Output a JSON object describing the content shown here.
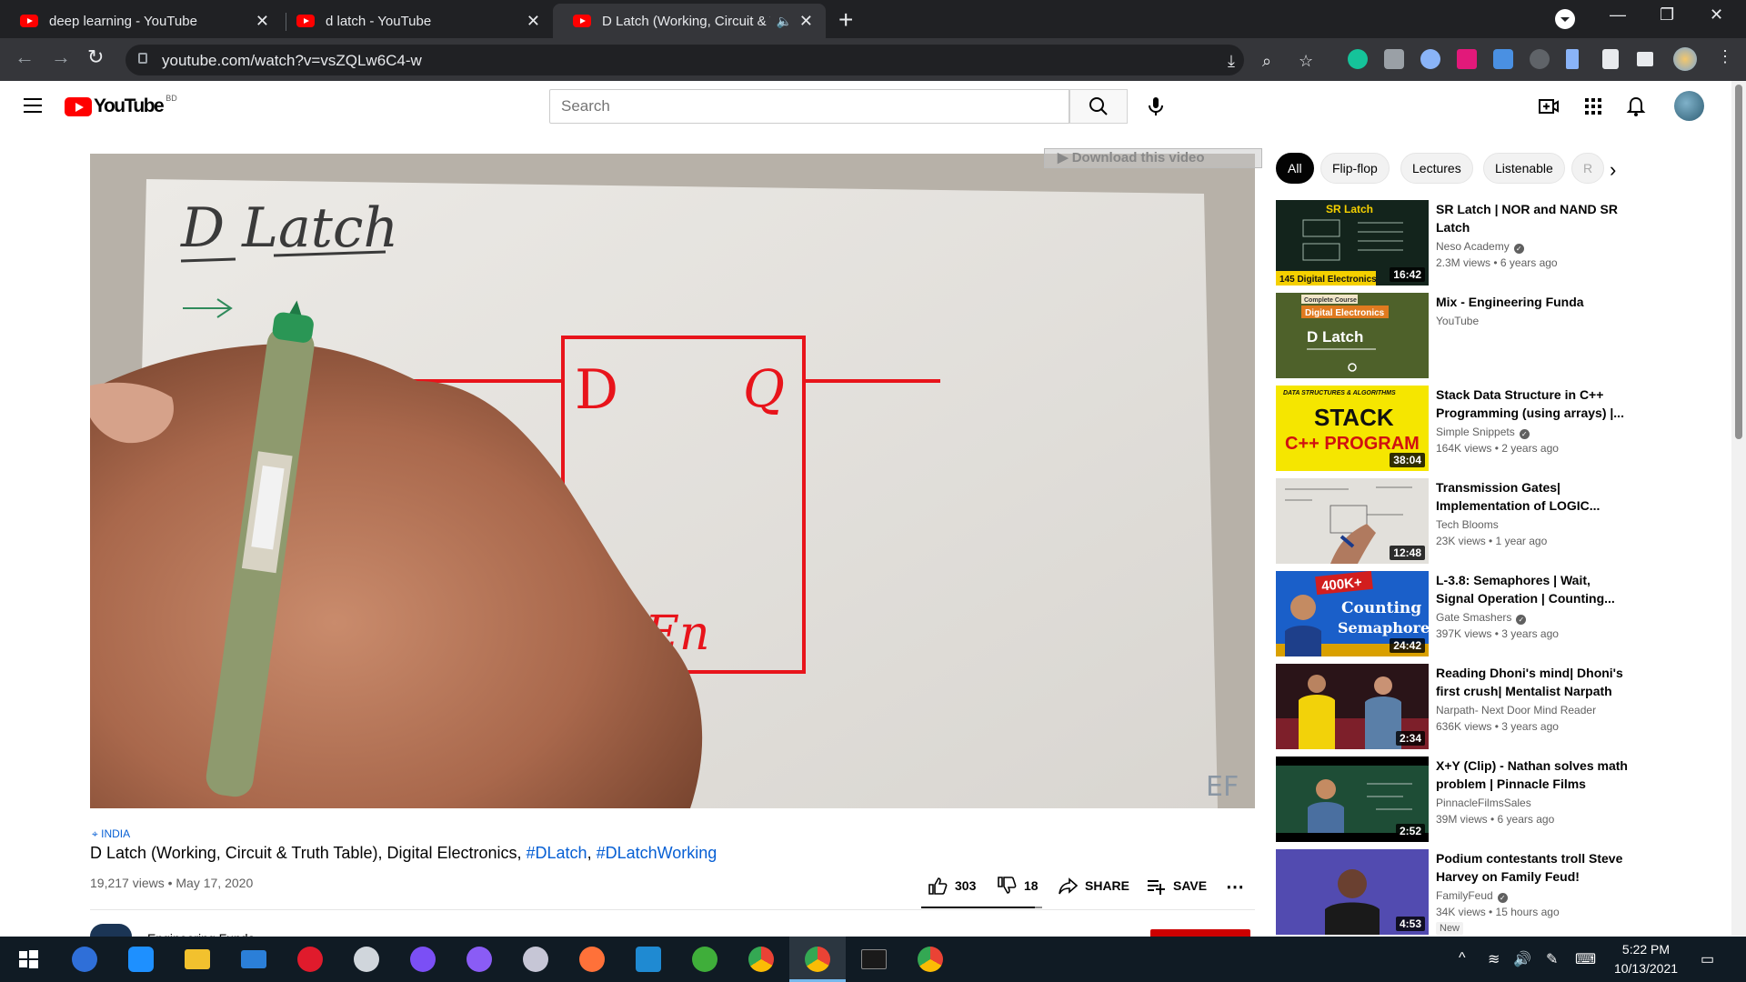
{
  "browser": {
    "tabs": [
      {
        "title": "deep learning - YouTube"
      },
      {
        "title": "d latch - YouTube"
      },
      {
        "title": "D Latch (Working, Circuit & T"
      }
    ],
    "url": "youtube.com/watch?v=vsZQLw6C4-w"
  },
  "header": {
    "logo_text": "YouTube",
    "country_code": "BD",
    "search_placeholder": "Search"
  },
  "player": {
    "download_banner": "Download this video",
    "whiteboard_text": {
      "title": "D Latch",
      "input_label": "D",
      "output_label": "Q",
      "enable_label": "En",
      "watermark": "EF"
    }
  },
  "video": {
    "location": "INDIA",
    "title_prefix": "D Latch (Working, Circuit & Truth Table), Digital Electronics, ",
    "hashtag_1": "#DLatch",
    "separator": ", ",
    "hashtag_2": "#DLatchWorking",
    "views_date": "19,217 views • May 17, 2020",
    "likes": "303",
    "dislikes": "18",
    "like_ratio": 0.94,
    "share_label": "SHARE",
    "save_label": "SAVE",
    "channel_name": "Engineering Funda"
  },
  "chips": [
    "All",
    "Flip-flop",
    "Lectures",
    "Listenable",
    "R"
  ],
  "recommendations": [
    {
      "title": "SR Latch | NOR and NAND SR Latch",
      "channel": "Neso Academy",
      "verified": true,
      "meta": "2.3M views • 6 years ago",
      "duration": "16:42",
      "thumb_text": "SR Latch",
      "thumb_sub": "145 Digital Electronics"
    },
    {
      "title": "Mix - Engineering Funda",
      "channel": "YouTube",
      "verified": false,
      "meta": "",
      "duration": "",
      "thumb_text": "D Latch",
      "thumb_sub": "Digital Electronics",
      "thumb_top": "Complete Course"
    },
    {
      "title": "Stack Data Structure in C++ Programming (using arrays) |...",
      "channel": "Simple Snippets",
      "verified": true,
      "meta": "164K views • 2 years ago",
      "duration": "38:04",
      "thumb_text": "STACK",
      "thumb_sub": "C++ PROGRAM",
      "thumb_top": "DATA STRUCTURES & ALGORITHMS"
    },
    {
      "title": "Transmission Gates| Implementation of LOGIC...",
      "channel": "Tech Blooms",
      "verified": false,
      "meta": "23K views • 1 year ago",
      "duration": "12:48"
    },
    {
      "title": "L-3.8: Semaphores | Wait, Signal Operation | Counting...",
      "channel": "Gate Smashers",
      "verified": true,
      "meta": "397K views • 3 years ago",
      "duration": "24:42",
      "thumb_text": "Counting",
      "thumb_sub": "Semaphore",
      "thumb_top": "400K+"
    },
    {
      "title": "Reading Dhoni's mind| Dhoni's first crush| Mentalist Narpath",
      "channel": "Narpath- Next Door Mind Reader",
      "verified": false,
      "meta": "636K views • 3 years ago",
      "duration": "2:34"
    },
    {
      "title": "X+Y (Clip) - Nathan solves math problem | Pinnacle Films",
      "channel": "PinnacleFilmsSales",
      "verified": false,
      "meta": "39M views • 6 years ago",
      "duration": "2:52"
    },
    {
      "title": "Podium contestants troll Steve Harvey on Family Feud!",
      "channel": "FamilyFeud",
      "verified": true,
      "meta": "34K views • 15 hours ago",
      "duration": "4:53",
      "badge": "New"
    }
  ],
  "taskbar": {
    "time": "5:22 PM",
    "date": "10/13/2021"
  },
  "colors": {
    "youtube_red": "#ff0000",
    "link_blue": "#065fd4",
    "marker_red": "#e8141b"
  }
}
